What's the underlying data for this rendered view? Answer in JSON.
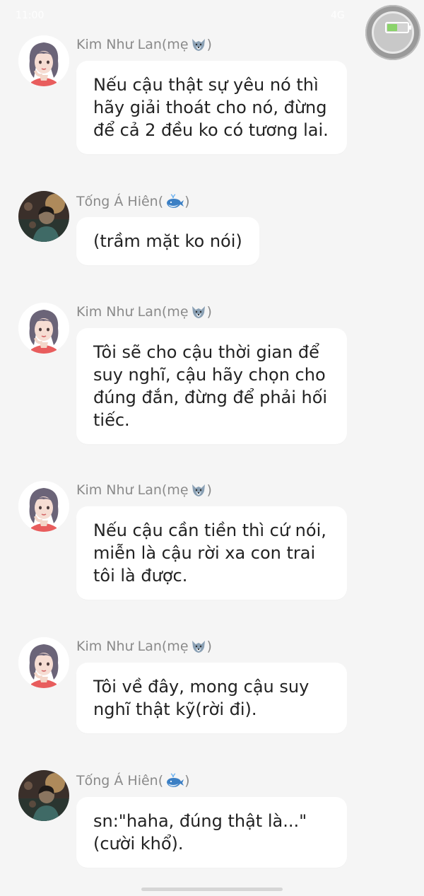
{
  "status": {
    "time": "11:00",
    "signal": "4G"
  },
  "messages": [
    {
      "sender": "Kim Như Lan(mẹ",
      "emoji_icon": "wolf-icon",
      "closing": ")",
      "avatar": "woman-avatar",
      "text": "Nếu cậu thật sự yêu nó thì hãy giải thoát cho nó, đừng để cả 2 đều ko có tương lai."
    },
    {
      "sender": "Tống Á Hiên(",
      "emoji_icon": "whale-icon",
      "closing": ")",
      "avatar": "man-avatar",
      "text": "(trầm mặt ko nói)"
    },
    {
      "sender": "Kim Như Lan(mẹ",
      "emoji_icon": "wolf-icon",
      "closing": ")",
      "avatar": "woman-avatar",
      "text": "Tôi sẽ cho cậu thời gian để suy nghĩ, cậu hãy chọn cho đúng đắn, đừng để phải hối tiếc."
    },
    {
      "sender": "Kim Như Lan(mẹ",
      "emoji_icon": "wolf-icon",
      "closing": ")",
      "avatar": "woman-avatar",
      "text": "Nếu cậu cần tiền thì cứ nói, miễn là cậu rời xa con trai tôi là được."
    },
    {
      "sender": "Kim Như Lan(mẹ",
      "emoji_icon": "wolf-icon",
      "closing": ")",
      "avatar": "woman-avatar",
      "text": "Tôi về đây, mong cậu suy nghĩ thật kỹ(rời đi)."
    },
    {
      "sender": "Tống Á Hiên(",
      "emoji_icon": "whale-icon",
      "closing": ")",
      "avatar": "man-avatar",
      "text": "sn:\"haha, đúng thật là...\"(cười khổ)."
    }
  ]
}
